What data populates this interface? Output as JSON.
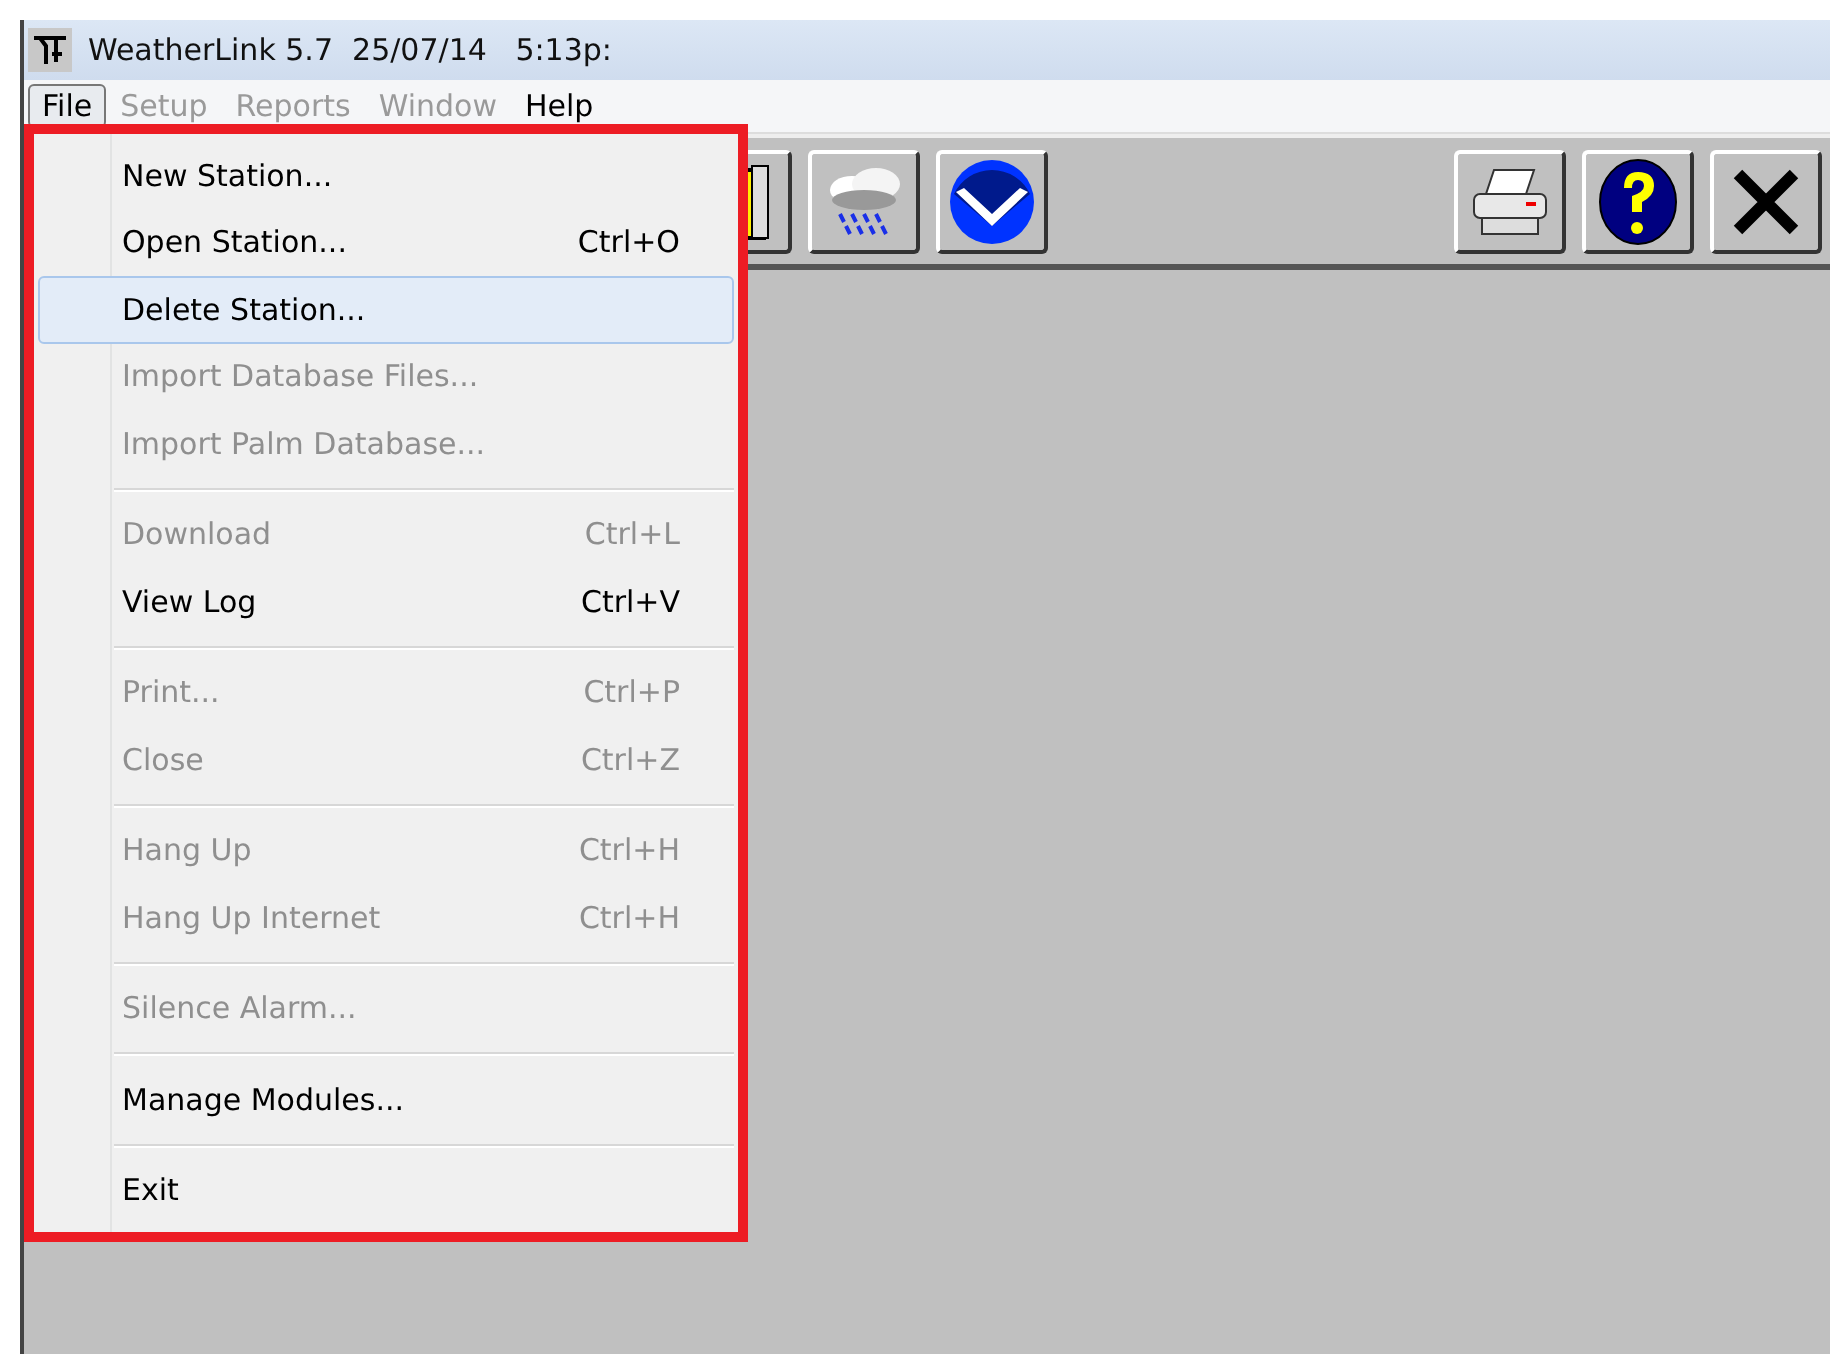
{
  "window": {
    "title": "WeatherLink 5.7  25/07/14   5:13p:"
  },
  "menubar": [
    {
      "label": "File",
      "selected": true,
      "disabled": false
    },
    {
      "label": "Setup",
      "selected": false,
      "disabled": true
    },
    {
      "label": "Reports",
      "selected": false,
      "disabled": true
    },
    {
      "label": "Window",
      "selected": false,
      "disabled": true
    },
    {
      "label": "Help",
      "selected": false,
      "disabled": false
    }
  ],
  "toolbar": {
    "left": [
      {
        "kind": "book"
      },
      {
        "kind": "rain"
      },
      {
        "kind": "noaa"
      }
    ],
    "right": [
      {
        "kind": "print"
      },
      {
        "kind": "help"
      },
      {
        "kind": "close"
      }
    ]
  },
  "menu": {
    "items": [
      {
        "kind": "item",
        "label": "New Station...",
        "disabled": false,
        "selected": false
      },
      {
        "kind": "item",
        "label": "Open Station...",
        "shortcut": "Ctrl+O",
        "disabled": false,
        "selected": false
      },
      {
        "kind": "item",
        "label": "Delete Station...",
        "disabled": false,
        "selected": true
      },
      {
        "kind": "item",
        "label": "Import Database Files...",
        "disabled": true,
        "selected": false
      },
      {
        "kind": "item",
        "label": "Import Palm Database...",
        "disabled": true,
        "selected": false
      },
      {
        "kind": "separator"
      },
      {
        "kind": "item",
        "label": "Download",
        "shortcut": "Ctrl+L",
        "disabled": true,
        "selected": false
      },
      {
        "kind": "item",
        "label": "View Log",
        "shortcut": "Ctrl+V",
        "disabled": false,
        "selected": false
      },
      {
        "kind": "separator"
      },
      {
        "kind": "item",
        "label": "Print...",
        "shortcut": "Ctrl+P",
        "disabled": true,
        "selected": false
      },
      {
        "kind": "item",
        "label": "Close",
        "shortcut": "Ctrl+Z",
        "disabled": true,
        "selected": false
      },
      {
        "kind": "separator"
      },
      {
        "kind": "item",
        "label": "Hang Up",
        "shortcut": "Ctrl+H",
        "disabled": true,
        "selected": false
      },
      {
        "kind": "item",
        "label": "Hang Up Internet",
        "shortcut": "Ctrl+H",
        "disabled": true,
        "selected": false
      },
      {
        "kind": "separator"
      },
      {
        "kind": "item",
        "label": "Silence Alarm...",
        "disabled": true,
        "selected": false
      },
      {
        "kind": "separator"
      },
      {
        "kind": "item",
        "label": "Manage Modules...",
        "disabled": false,
        "selected": false
      },
      {
        "kind": "separator"
      },
      {
        "kind": "item",
        "label": "Exit",
        "disabled": false,
        "selected": false
      }
    ]
  }
}
